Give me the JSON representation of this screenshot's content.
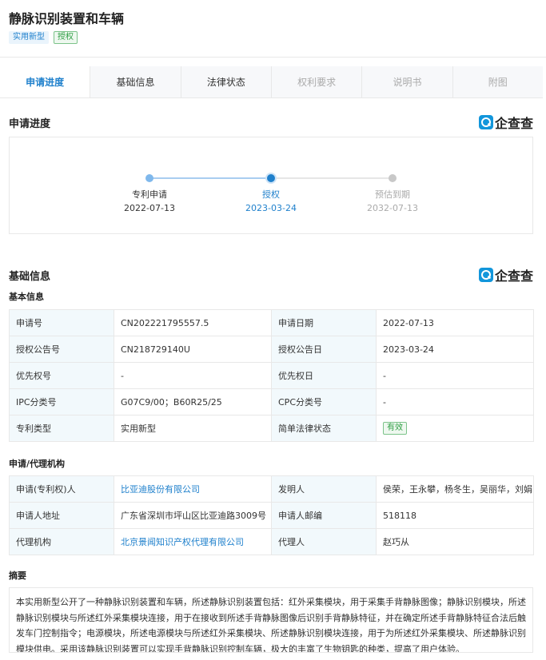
{
  "header": {
    "title": "静脉识别装置和车辆",
    "tag_type": "实用新型",
    "tag_status": "授权"
  },
  "tabs": [
    {
      "label": "申请进度",
      "state": "active"
    },
    {
      "label": "基础信息",
      "state": "normal"
    },
    {
      "label": "法律状态",
      "state": "normal"
    },
    {
      "label": "权利要求",
      "state": "disabled"
    },
    {
      "label": "说明书",
      "state": "disabled"
    },
    {
      "label": "附图",
      "state": "disabled"
    }
  ],
  "brand": {
    "name": "企查查",
    "icon": "qcc-logo-icon",
    "color": "#1296db"
  },
  "progress": {
    "title": "申请进度",
    "steps": [
      {
        "label": "专利申请",
        "date": "2022-07-13",
        "state": "done"
      },
      {
        "label": "授权",
        "date": "2023-03-24",
        "state": "current"
      },
      {
        "label": "预估到期",
        "date": "2032-07-13",
        "state": "future"
      }
    ]
  },
  "basic": {
    "title": "基础信息",
    "subtitle": "基本信息",
    "rows": [
      {
        "l1": "申请号",
        "v1": "CN202221795557.5",
        "l2": "申请日期",
        "v2": "2022-07-13"
      },
      {
        "l1": "授权公告号",
        "v1": "CN218729140U",
        "l2": "授权公告日",
        "v2": "2023-03-24"
      },
      {
        "l1": "优先权号",
        "v1": "-",
        "l2": "优先权日",
        "v2": "-"
      },
      {
        "l1": "IPC分类号",
        "v1": "G07C9/00；B60R25/25",
        "l2": "CPC分类号",
        "v2": "-"
      },
      {
        "l1": "专利类型",
        "v1": "实用新型",
        "l2": "简单法律状态",
        "v2": "有效"
      }
    ]
  },
  "agency": {
    "subtitle": "申请/代理机构",
    "rows": [
      {
        "l1": "申请(专利权)人",
        "v1": "比亚迪股份有限公司",
        "l2": "发明人",
        "v2": "侯荣，王永攀，杨冬生，吴丽华，刘娟"
      },
      {
        "l1": "申请人地址",
        "v1": "广东省深圳市坪山区比亚迪路3009号",
        "l2": "申请人邮编",
        "v2": "518118"
      },
      {
        "l1": "代理机构",
        "v1": "北京景闻知识产权代理有限公司",
        "l2": "代理人",
        "v2": "赵巧从"
      }
    ]
  },
  "abstract": {
    "subtitle": "摘要",
    "text": "本实用新型公开了一种静脉识别装置和车辆，所述静脉识别装置包括：红外采集模块，用于采集手背静脉图像；静脉识别模块，所述静脉识别模块与所述红外采集模块连接，用于在接收到所述手背静脉图像后识别手背静脉特征，并在确定所述手背静脉特征合法后触发车门控制指令；电源模块，所述电源模块与所述红外采集模块、所述静脉识别模块连接，用于为所述红外采集模块、所述静脉识别模块供电。采用该静脉识别装置可以实现手背静脉识别控制车辆，极大的丰富了生物钥匙的种类，提高了用户体验。"
  },
  "colors": {
    "accent": "#1f80cc",
    "valid": "#2f9e44",
    "label_bg": "#f2f9fc"
  }
}
